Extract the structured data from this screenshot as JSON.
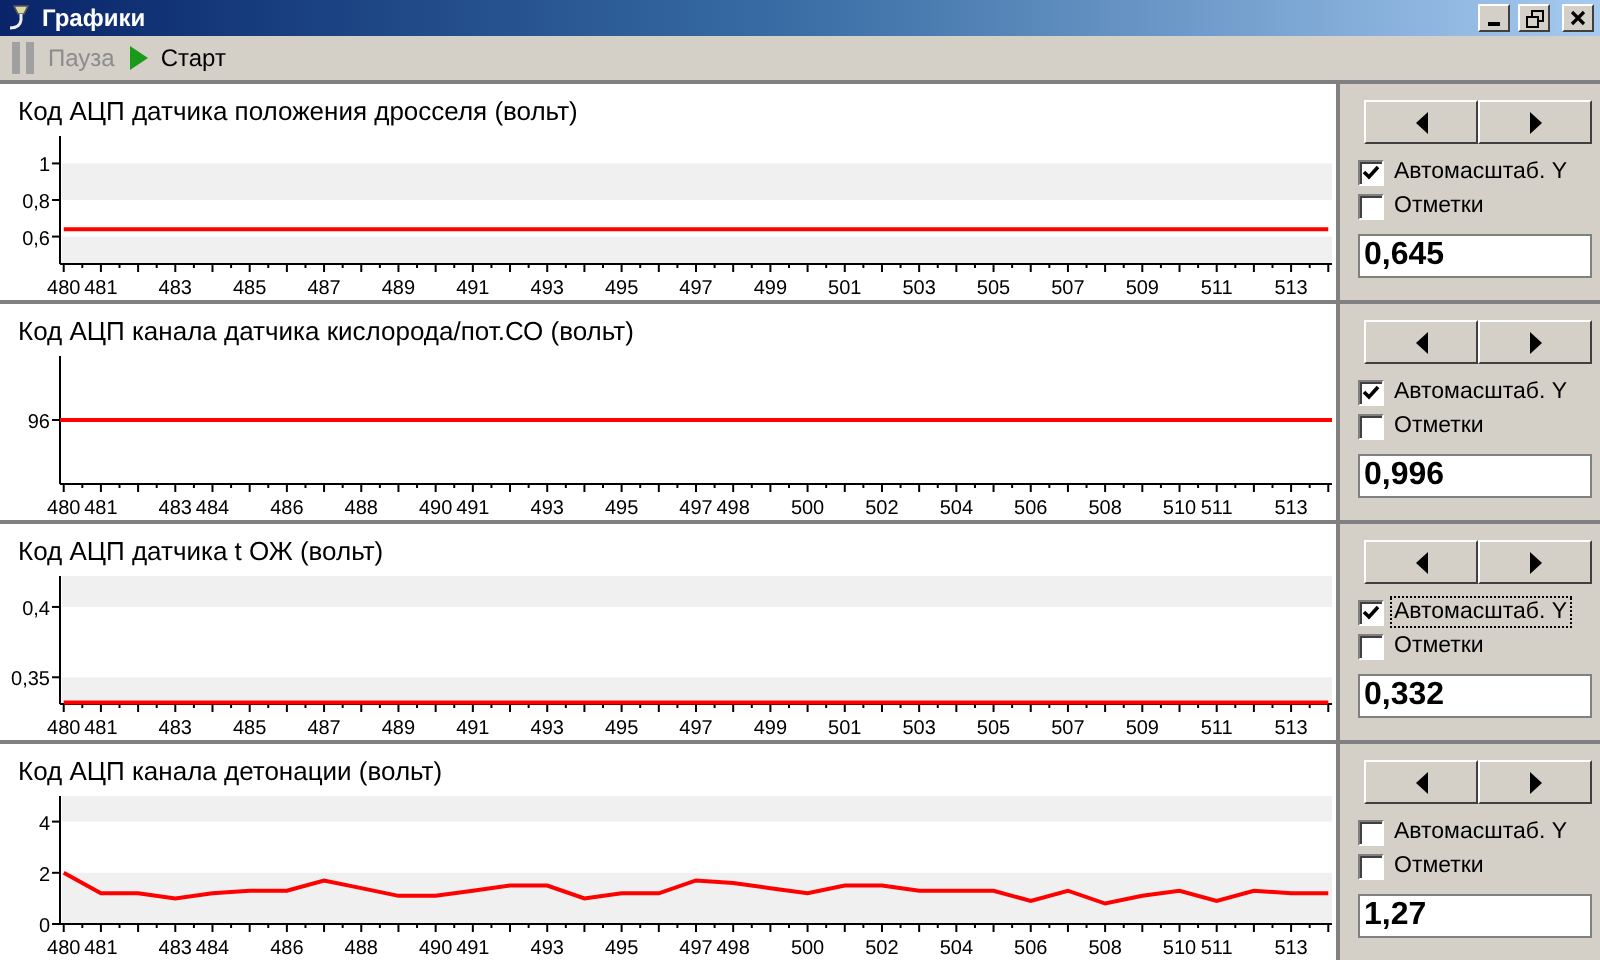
{
  "window": {
    "title": "Графики"
  },
  "toolbar": [
    {
      "kind": "pause",
      "label": "Пауза",
      "disabled": true
    },
    {
      "kind": "start",
      "label": "Старт",
      "disabled": false
    }
  ],
  "panels": [
    {
      "title": "Код АЦП датчика положения дросселя (вольт)",
      "autoscale": {
        "label": "Автомасштаб. Y",
        "checked": true,
        "focused": false
      },
      "marks": {
        "label": "Отметки",
        "checked": false
      },
      "value": "0,645",
      "chart_data": {
        "type": "line",
        "x": [
          480,
          514
        ],
        "series": [
          {
            "color": "#ff0000",
            "values": [
              0.64,
              0.64
            ]
          }
        ],
        "xlim": [
          479.9,
          514.1
        ],
        "ylim": [
          0.45,
          1.15
        ],
        "xticks": [
          480,
          481,
          483,
          485,
          487,
          489,
          491,
          493,
          495,
          497,
          499,
          501,
          503,
          505,
          507,
          509,
          511,
          513
        ],
        "yticks": [
          {
            "value": 0.6,
            "label": "0,6"
          },
          {
            "value": 0.8,
            "label": "0,8"
          },
          {
            "value": 1,
            "label": "1"
          }
        ]
      }
    },
    {
      "title": "Код АЦП канала датчика кислорода/пот.СО (вольт)",
      "autoscale": {
        "label": "Автомасштаб. Y",
        "checked": true,
        "focused": false
      },
      "marks": {
        "label": "Отметки",
        "checked": false
      },
      "value": "0,996",
      "plot": {
        "x_labels": [
          "480",
          "481",
          "483",
          "484",
          "486",
          "488",
          "490",
          "491",
          "493",
          "495",
          "497",
          "498",
          "500",
          "502",
          "504",
          "506",
          "508",
          "510",
          "511",
          "513"
        ],
        "y_label": "96"
      }
    },
    {
      "title": "Код АЦП датчика t ОЖ (вольт)",
      "autoscale": {
        "label": "Автомасштаб. Y",
        "checked": true,
        "focused": true
      },
      "marks": {
        "label": "Отметки",
        "checked": false
      },
      "value": "0,332",
      "chart_data": {
        "type": "line",
        "x": [
          480,
          514
        ],
        "series": [
          {
            "color": "#ff0000",
            "values": [
              0.332,
              0.332
            ]
          }
        ],
        "xlim": [
          479.9,
          514.1
        ],
        "ylim": [
          0.331,
          0.422
        ],
        "xticks": [
          480,
          481,
          483,
          485,
          487,
          489,
          491,
          493,
          495,
          497,
          499,
          501,
          503,
          505,
          507,
          509,
          511,
          513
        ],
        "yticks": [
          {
            "value": 0.35,
            "label": "0,35"
          },
          {
            "value": 0.4,
            "label": "0,4"
          }
        ]
      }
    },
    {
      "title": "Код АЦП канала детонации (вольт)",
      "autoscale": {
        "label": "Автомасштаб. Y",
        "checked": false,
        "focused": false
      },
      "marks": {
        "label": "Отметки",
        "checked": false
      },
      "value": "1,27",
      "chart_data": {
        "type": "line",
        "x": [
          480,
          481,
          482,
          483,
          484,
          485,
          486,
          487,
          488,
          489,
          490,
          491,
          492,
          493,
          494,
          495,
          496,
          497,
          498,
          499,
          500,
          501,
          502,
          503,
          504,
          505,
          506,
          507,
          508,
          509,
          510,
          511,
          512,
          513,
          514
        ],
        "series": [
          {
            "color": "#ff0000",
            "values": [
              2.0,
              1.2,
              1.2,
              1.0,
              1.2,
              1.3,
              1.3,
              1.7,
              1.4,
              1.1,
              1.1,
              1.3,
              1.5,
              1.5,
              1.0,
              1.2,
              1.2,
              1.7,
              1.6,
              1.4,
              1.2,
              1.5,
              1.5,
              1.3,
              1.3,
              1.3,
              0.9,
              1.3,
              0.8,
              1.1,
              1.3,
              0.9,
              1.3,
              1.2,
              1.2
            ]
          }
        ],
        "xlim": [
          479.9,
          514.1
        ],
        "ylim": [
          0,
          5
        ],
        "xticks": [
          480,
          481,
          483,
          484,
          486,
          488,
          490,
          491,
          493,
          495,
          497,
          498,
          500,
          502,
          504,
          506,
          508,
          510,
          511,
          513
        ],
        "yticks": [
          0,
          2,
          4
        ]
      }
    }
  ]
}
